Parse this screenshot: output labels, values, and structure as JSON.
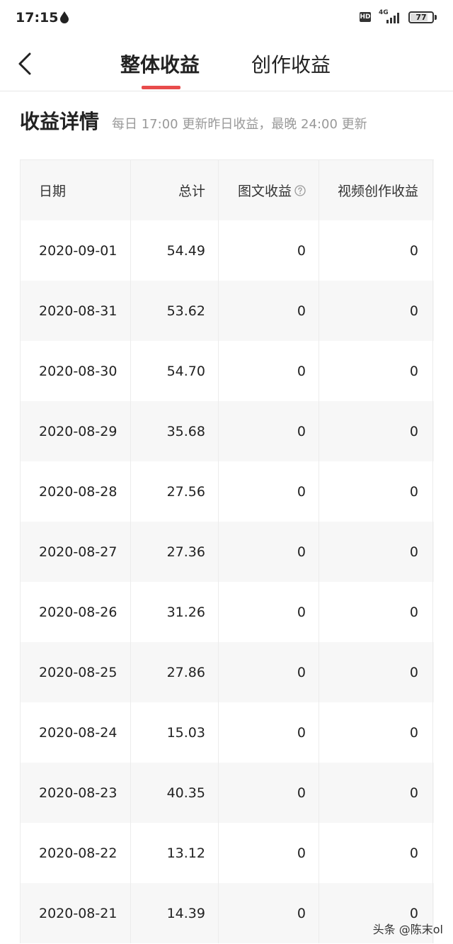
{
  "status_bar": {
    "time": "17:15",
    "hd_badge": "HD",
    "network": "4G",
    "battery": "77"
  },
  "nav": {
    "tabs": [
      {
        "label": "整体收益",
        "active": true
      },
      {
        "label": "创作收益",
        "active": false
      }
    ],
    "accent_color": "#e84c4c"
  },
  "section": {
    "title": "收益详情",
    "note": "每日 17:00 更新昨日收益，最晚 24:00 更新"
  },
  "table": {
    "headers": [
      "日期",
      "总计",
      "图文收益",
      "视频创作收益"
    ],
    "rows": [
      [
        "2020-09-01",
        "54.49",
        "0",
        "0"
      ],
      [
        "2020-08-31",
        "53.62",
        "0",
        "0"
      ],
      [
        "2020-08-30",
        "54.70",
        "0",
        "0"
      ],
      [
        "2020-08-29",
        "35.68",
        "0",
        "0"
      ],
      [
        "2020-08-28",
        "27.56",
        "0",
        "0"
      ],
      [
        "2020-08-27",
        "27.36",
        "0",
        "0"
      ],
      [
        "2020-08-26",
        "31.26",
        "0",
        "0"
      ],
      [
        "2020-08-25",
        "27.86",
        "0",
        "0"
      ],
      [
        "2020-08-24",
        "15.03",
        "0",
        "0"
      ],
      [
        "2020-08-23",
        "40.35",
        "0",
        "0"
      ],
      [
        "2020-08-22",
        "13.12",
        "0",
        "0"
      ],
      [
        "2020-08-21",
        "14.39",
        "0",
        "0"
      ]
    ]
  },
  "watermark": "头条 @陈末ol"
}
